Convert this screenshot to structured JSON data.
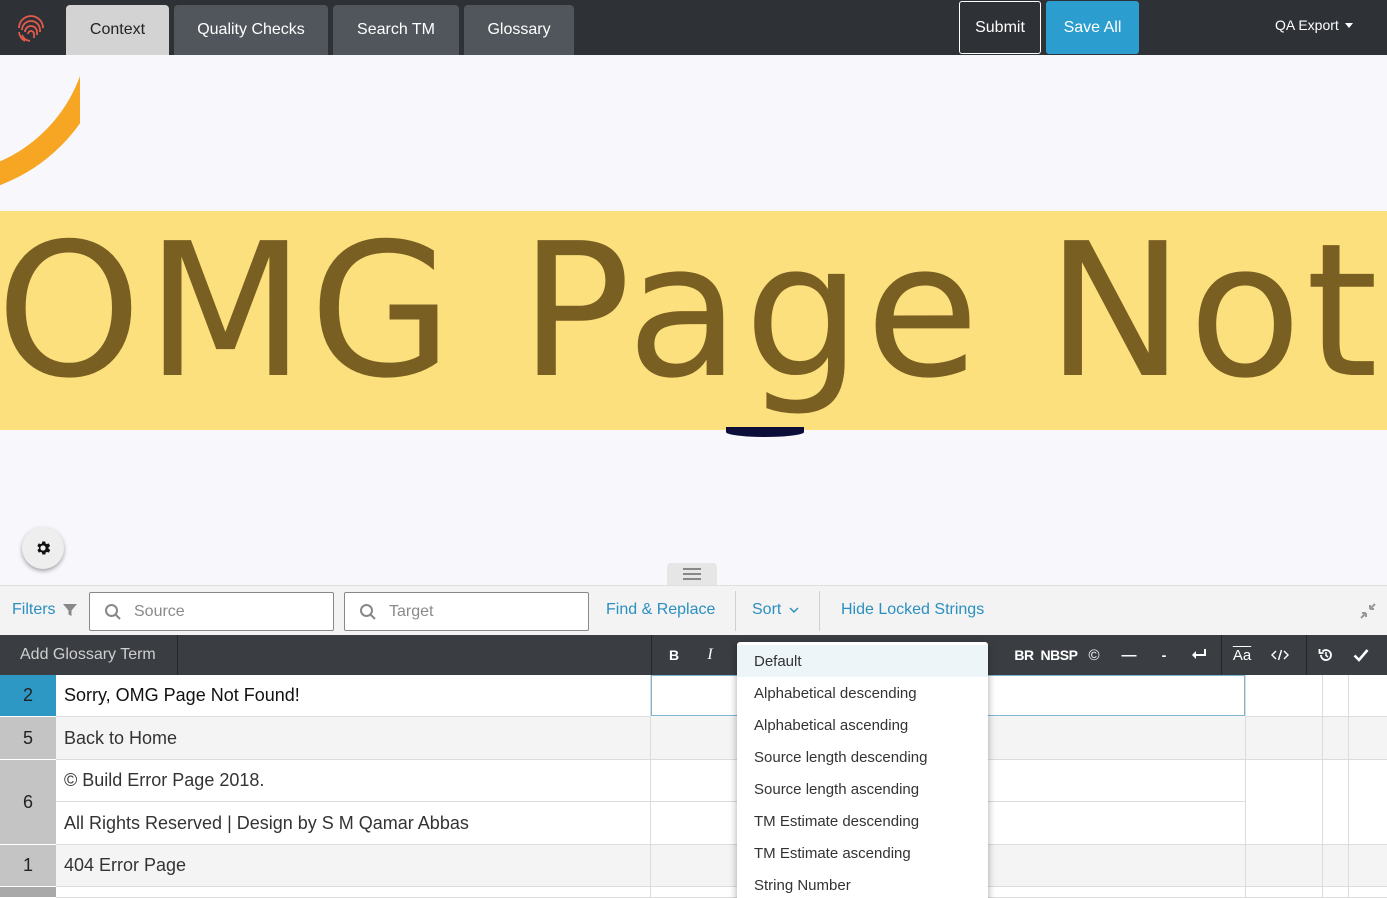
{
  "topbar": {
    "tabs": [
      {
        "label": "Context",
        "active": true
      },
      {
        "label": "Quality Checks",
        "active": false
      },
      {
        "label": "Search TM",
        "active": false
      },
      {
        "label": "Glossary",
        "active": false
      }
    ],
    "submit_label": "Submit",
    "save_all_label": "Save All",
    "qa_export_label": "QA Export"
  },
  "preview": {
    "banner_text": "OMG Page Not F",
    "accent_color": "#fbe07d",
    "text_color": "#7a5f22",
    "arc_color": "#f6a623"
  },
  "filterbar": {
    "filters_label": "Filters",
    "source_placeholder": "Source",
    "target_placeholder": "Target",
    "find_replace_label": "Find & Replace",
    "sort_label": "Sort",
    "hide_locked_label": "Hide Locked Strings"
  },
  "tablebar": {
    "add_glossary_label": "Add Glossary Term",
    "tools": {
      "bold": "B",
      "italic": "I",
      "br": "BR",
      "nbsp": "NBSP",
      "copyright": "©",
      "em_dash": "—",
      "hyphen": "-",
      "case": "Aa"
    }
  },
  "rows": [
    {
      "num": "2",
      "segments": [
        "Sorry, OMG Page Not Found!"
      ],
      "selected": true
    },
    {
      "num": "5",
      "segments": [
        "Back to Home"
      ],
      "selected": false
    },
    {
      "num": "6",
      "segments": [
        "© Build Error Page 2018.",
        "All Rights Reserved | Design by S M Qamar Abbas"
      ],
      "selected": false
    },
    {
      "num": "1",
      "segments": [
        "404 Error Page"
      ],
      "selected": false
    }
  ],
  "sort_menu": {
    "options": [
      "Default",
      "Alphabetical descending",
      "Alphabetical ascending",
      "Source length descending",
      "Source length ascending",
      "TM Estimate descending",
      "TM Estimate ascending",
      "String Number"
    ],
    "selected": "Default"
  },
  "colors": {
    "topbar_bg": "#2e3135",
    "primary": "#2b9ecf",
    "link": "#2b8fc0",
    "selected_row": "#2d98c4"
  }
}
